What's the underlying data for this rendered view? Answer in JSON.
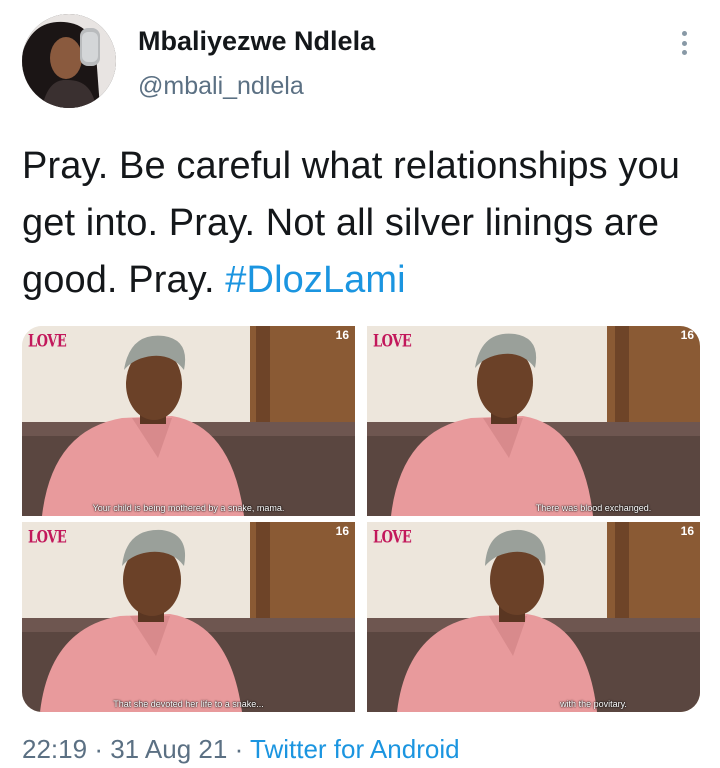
{
  "user": {
    "display_name": "Mbaliyezwe Ndlela",
    "handle": "@mbali_ndlela",
    "avatar_icon": "profile-photo"
  },
  "tweet": {
    "text": "Pray. Be careful what relationships you get into. Pray. Not all silver linings are good. Pray.",
    "hashtag": "#DlozLami"
  },
  "media": [
    {
      "logo": "LOVE",
      "episode": "16",
      "subtitle": "Your child is being mothered by a snake, mama."
    },
    {
      "logo": "LOVE",
      "episode": "16",
      "subtitle": "There was blood exchanged."
    },
    {
      "logo": "LOVE",
      "episode": "16",
      "subtitle": "That she devoted her life to a snake..."
    },
    {
      "logo": "LOVE",
      "episode": "16",
      "subtitle": "with the povitary."
    }
  ],
  "meta": {
    "time": "22:19",
    "date": "31 Aug 21",
    "separator": "·",
    "client": "Twitter for Android"
  },
  "colors": {
    "link": "#1b95e0",
    "secondary_text": "#5b7083",
    "primary_text": "#14171a"
  }
}
